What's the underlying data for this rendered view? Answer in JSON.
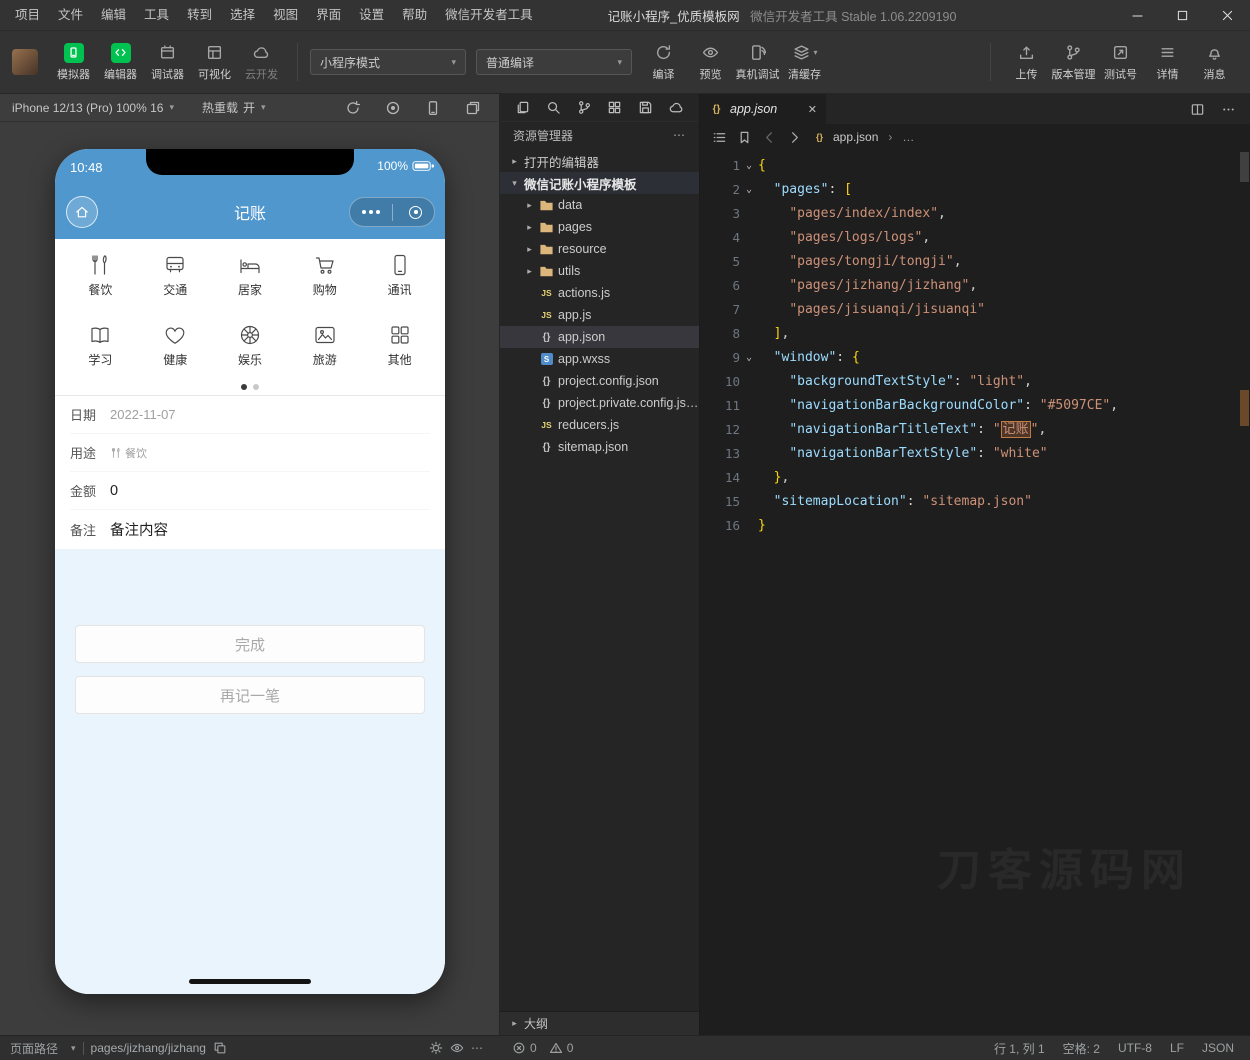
{
  "menu_bar": {
    "items": [
      "项目",
      "文件",
      "编辑",
      "工具",
      "转到",
      "选择",
      "视图",
      "界面",
      "设置",
      "帮助",
      "微信开发者工具"
    ],
    "title_primary": "记账小程序_优质模板网",
    "title_secondary": "微信开发者工具 Stable 1.06.2209190"
  },
  "toolbar": {
    "modules": [
      {
        "label": "模拟器",
        "icon": "simulator-icon",
        "green": true
      },
      {
        "label": "编辑器",
        "icon": "code-icon",
        "green": true
      },
      {
        "label": "调试器",
        "icon": "debugger-icon"
      },
      {
        "label": "可视化",
        "icon": "visual-icon"
      },
      {
        "label": "云开发",
        "icon": "cloud-icon",
        "dim": true
      }
    ],
    "mode_select": "小程序模式",
    "compile_select": "普通编译",
    "actions": [
      {
        "label": "编译",
        "icon": "compile-icon"
      },
      {
        "label": "预览",
        "icon": "preview-icon"
      },
      {
        "label": "真机调试",
        "icon": "device-debug-icon"
      },
      {
        "label": "清缓存",
        "icon": "clear-cache-icon",
        "caret": true
      }
    ],
    "right_actions": [
      {
        "label": "上传",
        "icon": "upload-icon"
      },
      {
        "label": "版本管理",
        "icon": "version-icon"
      },
      {
        "label": "测试号",
        "icon": "testid-icon"
      },
      {
        "label": "详情",
        "icon": "details-icon"
      },
      {
        "label": "消息",
        "icon": "message-icon"
      }
    ]
  },
  "simulator": {
    "device_select": "iPhone 12/13 (Pro) 100% 16",
    "hot_reload_label": "热重载",
    "hot_reload_state": "开",
    "toolbar_icons": [
      "rotate-icon",
      "record-icon",
      "device-icon",
      "windows-icon"
    ],
    "phone": {
      "time": "10:48",
      "battery": "100%",
      "nav_title": "记账",
      "accent_color": "#5097CE",
      "categories": [
        {
          "label": "餐饮",
          "icon": "dining-icon"
        },
        {
          "label": "交通",
          "icon": "transport-icon"
        },
        {
          "label": "居家",
          "icon": "household-icon"
        },
        {
          "label": "购物",
          "icon": "shopping-icon"
        },
        {
          "label": "通讯",
          "icon": "comm-icon"
        },
        {
          "label": "学习",
          "icon": "study-icon"
        },
        {
          "label": "健康",
          "icon": "health-icon"
        },
        {
          "label": "娱乐",
          "icon": "fun-icon"
        },
        {
          "label": "旅游",
          "icon": "travel-icon"
        },
        {
          "label": "其他",
          "icon": "other-icon"
        }
      ],
      "form": [
        {
          "key": "date",
          "label": "日期",
          "value": "2022-11-07",
          "style": "muted"
        },
        {
          "key": "purpose",
          "label": "用途",
          "value": "餐饮",
          "style": "small",
          "icon": "dining-icon"
        },
        {
          "key": "amount",
          "label": "金额",
          "value": "0",
          "style": "dark"
        },
        {
          "key": "note",
          "label": "备注",
          "value": "备注内容",
          "style": "dark"
        }
      ],
      "buttons": [
        {
          "key": "finish",
          "label": "完成"
        },
        {
          "key": "again",
          "label": "再记一笔"
        }
      ]
    }
  },
  "explorer": {
    "toolbar_icons": [
      "files-icon",
      "search-icon",
      "branch-icon",
      "modules-icon",
      "save-icon",
      "cloud-icon"
    ],
    "title": "资源管理器",
    "tree": [
      {
        "label": "打开的编辑器",
        "type": "section",
        "chevron": "right",
        "indent": 0
      },
      {
        "label": "微信记账小程序模板",
        "type": "section",
        "chevron": "down",
        "indent": 0,
        "emph": true
      },
      {
        "label": "data",
        "type": "folder",
        "chevron": "right",
        "indent": 1
      },
      {
        "label": "pages",
        "type": "folder",
        "chevron": "right",
        "indent": 1
      },
      {
        "label": "resource",
        "type": "folder",
        "chevron": "right",
        "indent": 1
      },
      {
        "label": "utils",
        "type": "folder",
        "chevron": "right",
        "indent": 1
      },
      {
        "label": "actions.js",
        "type": "js",
        "indent": 1
      },
      {
        "label": "app.js",
        "type": "js",
        "indent": 1
      },
      {
        "label": "app.json",
        "type": "json",
        "indent": 1,
        "selected": true
      },
      {
        "label": "app.wxss",
        "type": "wxss",
        "indent": 1
      },
      {
        "label": "project.config.json",
        "type": "json",
        "indent": 1
      },
      {
        "label": "project.private.config.js…",
        "type": "json",
        "indent": 1
      },
      {
        "label": "reducers.js",
        "type": "js",
        "indent": 1
      },
      {
        "label": "sitemap.json",
        "type": "json",
        "indent": 1
      }
    ],
    "outline_label": "大纲"
  },
  "editor": {
    "tab": {
      "name": "app.json"
    },
    "breadcrumb": {
      "file": "app.json",
      "more": "…"
    },
    "watermark": "刀客源码网",
    "code": {
      "fold_lines": [
        1,
        2,
        9
      ],
      "lines": [
        {
          "n": 1,
          "fold": true,
          "tokens": [
            [
              "b",
              "{"
            ]
          ]
        },
        {
          "n": 2,
          "fold": true,
          "tokens": [
            [
              "p",
              "  "
            ],
            [
              "k",
              "\"pages\""
            ],
            [
              "p",
              ": "
            ],
            [
              "b",
              "["
            ]
          ]
        },
        {
          "n": 3,
          "tokens": [
            [
              "p",
              "    "
            ],
            [
              "s",
              "\"pages/index/index\""
            ],
            [
              "p",
              ","
            ]
          ]
        },
        {
          "n": 4,
          "tokens": [
            [
              "p",
              "    "
            ],
            [
              "s",
              "\"pages/logs/logs\""
            ],
            [
              "p",
              ","
            ]
          ]
        },
        {
          "n": 5,
          "tokens": [
            [
              "p",
              "    "
            ],
            [
              "s",
              "\"pages/tongji/tongji\""
            ],
            [
              "p",
              ","
            ]
          ]
        },
        {
          "n": 6,
          "tokens": [
            [
              "p",
              "    "
            ],
            [
              "s",
              "\"pages/jizhang/jizhang\""
            ],
            [
              "p",
              ","
            ]
          ]
        },
        {
          "n": 7,
          "tokens": [
            [
              "p",
              "    "
            ],
            [
              "s",
              "\"pages/jisuanqi/jisuanqi\""
            ]
          ]
        },
        {
          "n": 8,
          "tokens": [
            [
              "p",
              "  "
            ],
            [
              "b",
              "]"
            ],
            [
              "p",
              ","
            ]
          ]
        },
        {
          "n": 9,
          "fold": true,
          "tokens": [
            [
              "p",
              "  "
            ],
            [
              "k",
              "\"window\""
            ],
            [
              "p",
              ": "
            ],
            [
              "b",
              "{"
            ]
          ]
        },
        {
          "n": 10,
          "tokens": [
            [
              "p",
              "    "
            ],
            [
              "k",
              "\"backgroundTextStyle\""
            ],
            [
              "p",
              ": "
            ],
            [
              "s",
              "\"light\""
            ],
            [
              "p",
              ","
            ]
          ]
        },
        {
          "n": 11,
          "tokens": [
            [
              "p",
              "    "
            ],
            [
              "k",
              "\"navigationBarBackgroundColor\""
            ],
            [
              "p",
              ": "
            ],
            [
              "s",
              "\"#5097CE\""
            ],
            [
              "p",
              ","
            ]
          ]
        },
        {
          "n": 12,
          "tokens": [
            [
              "p",
              "    "
            ],
            [
              "k",
              "\"navigationBarTitleText\""
            ],
            [
              "p",
              ": "
            ],
            [
              "s",
              "\""
            ],
            [
              "hl",
              "记账"
            ],
            [
              "s",
              "\""
            ],
            [
              "p",
              ","
            ]
          ]
        },
        {
          "n": 13,
          "tokens": [
            [
              "p",
              "    "
            ],
            [
              "k",
              "\"navigationBarTextStyle\""
            ],
            [
              "p",
              ": "
            ],
            [
              "s",
              "\"white\""
            ]
          ]
        },
        {
          "n": 14,
          "tokens": [
            [
              "p",
              "  "
            ],
            [
              "b",
              "}"
            ],
            [
              "p",
              ","
            ]
          ]
        },
        {
          "n": 15,
          "tokens": [
            [
              "p",
              "  "
            ],
            [
              "k",
              "\"sitemapLocation\""
            ],
            [
              "p",
              ": "
            ],
            [
              "s",
              "\"sitemap.json\""
            ]
          ]
        },
        {
          "n": 16,
          "tokens": [
            [
              "b",
              "}"
            ]
          ]
        }
      ]
    }
  },
  "status_bar": {
    "page_path_label": "页面路径",
    "page_path": "pages/jizhang/jizhang",
    "errors": "0",
    "warnings": "0",
    "line_col": "行 1, 列 1",
    "spaces": "空格: 2",
    "encoding": "UTF-8",
    "eol": "LF",
    "language": "JSON"
  }
}
